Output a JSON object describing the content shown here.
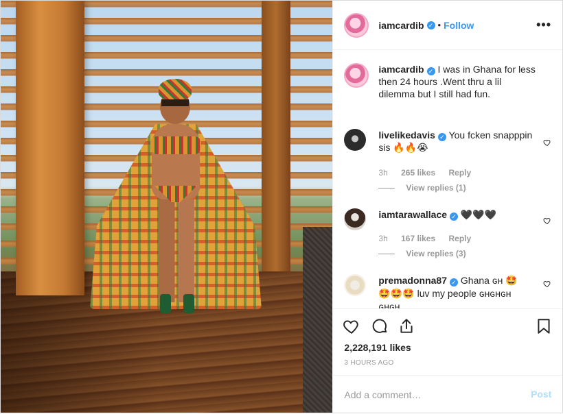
{
  "post": {
    "username": "iamcardib",
    "separator": "•",
    "follow_label": "Follow",
    "more_label": "•••"
  },
  "caption": {
    "username": "iamcardib",
    "text": "I was in Ghana for less then 24 hours .Went thru a lil dilemma but I still had fun."
  },
  "comments": [
    {
      "username": "livelikedavis",
      "verified": true,
      "text": "You fcken snapppin sis",
      "emojis": "🔥🔥😭",
      "time": "3h",
      "likes": "265 likes",
      "reply": "Reply",
      "view_replies": "View replies (1)"
    },
    {
      "username": "iamtarawallace",
      "verified": true,
      "text": "",
      "emojis": "🖤🖤🖤",
      "time": "3h",
      "likes": "167 likes",
      "reply": "Reply",
      "view_replies": "View replies (3)"
    },
    {
      "username": "premadonna87",
      "verified": true,
      "text_a": "Ghana ɢʜ",
      "emojis_a": "🤩",
      "emojis_b": "🤩🤩🤩",
      "text_b": "luv my people ɢʜɢʜɢʜ",
      "text_c": "ɢʜɢʜ"
    }
  ],
  "actions": {
    "likes_total": "2,228,191 likes",
    "time_ago": "3 HOURS AGO"
  },
  "add_comment": {
    "placeholder": "Add a comment…",
    "post_label": "Post"
  },
  "colors": {
    "accent": "#3897f0",
    "post_disabled": "#b2dffc",
    "muted": "#999999"
  }
}
